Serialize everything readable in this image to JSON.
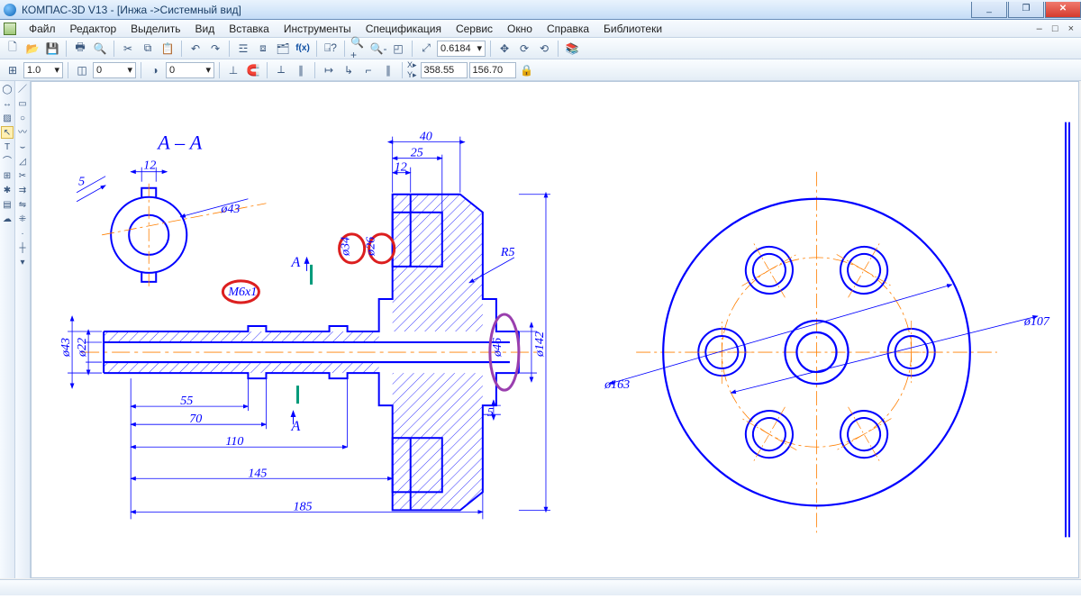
{
  "window": {
    "title": "КОМПАС-3D V13 - [Инжа ->Системный вид]",
    "minimize": "_",
    "maximize": "❐",
    "close": "✕"
  },
  "menu": {
    "items": [
      "Файл",
      "Редактор",
      "Выделить",
      "Вид",
      "Вставка",
      "Инструменты",
      "Спецификация",
      "Сервис",
      "Окно",
      "Справка",
      "Библиотеки"
    ]
  },
  "mdi": {
    "min": "–",
    "max": "□",
    "close": "×"
  },
  "toolbar1": {
    "zoom": "0.6184",
    "coord_prefix_x": "X",
    "coord_prefix_y": "Y"
  },
  "toolbar2": {
    "scale": "1.0",
    "layer": "0",
    "layer2": "0",
    "coord_x": "358.55",
    "coord_y": "156.70"
  },
  "drawing": {
    "section_label": "А – А",
    "section_mark_top": "А",
    "section_mark_bottom": "А",
    "dimensions": {
      "d5": "5",
      "d12a": "12",
      "phi43a": "ø43",
      "d40": "40",
      "d25": "25",
      "d12b": "12",
      "r5": "R5",
      "phi26": "ø26",
      "phi34": "ø34",
      "m6x1": "М6х1",
      "phi43b": "ø43",
      "phi22": "ø22",
      "phi46": "ø46",
      "phi142": "ø142",
      "d5b": "5",
      "d55": "55",
      "d70": "70",
      "d110": "110",
      "d145": "145",
      "d185": "185",
      "phi163": "ø163",
      "phi107": "ø107"
    }
  }
}
